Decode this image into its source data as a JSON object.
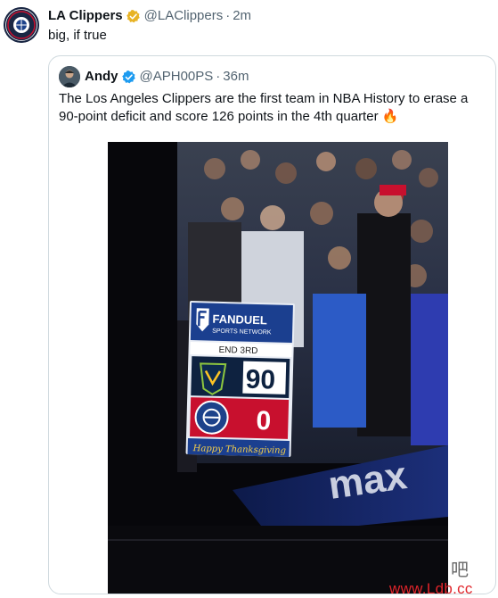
{
  "tweet": {
    "display_name": "LA Clippers",
    "handle": "@LAClippers",
    "separator": "·",
    "time": "2m",
    "text": "big, if true",
    "avatar_text": "LOS ANGELES CLIPPERS"
  },
  "quoted_tweet": {
    "display_name": "Andy",
    "handle": "@APH00PS",
    "separator": "·",
    "time": "36m",
    "text": "The Los Angeles Clippers are the first team in NBA History to erase a 90-point deficit and score 126 points in the 4th quarter 🔥"
  },
  "photo": {
    "scoreboard_brand": "FANDUEL",
    "scoreboard_sub": "SPORTS NETWORK",
    "period": "END 3RD",
    "away_score": "90",
    "home_score": "0",
    "banner": "Happy Thanksgiving",
    "court_text": "max"
  },
  "colors": {
    "verified": "#e8b325",
    "quote_verified": "#1d9bf0",
    "scoreboard_blue": "#1b3f8f",
    "home_red": "#c8102e",
    "away_navy": "#0e2240"
  },
  "watermark": {
    "logo": "吧",
    "url": "www.Ldb.cc"
  }
}
